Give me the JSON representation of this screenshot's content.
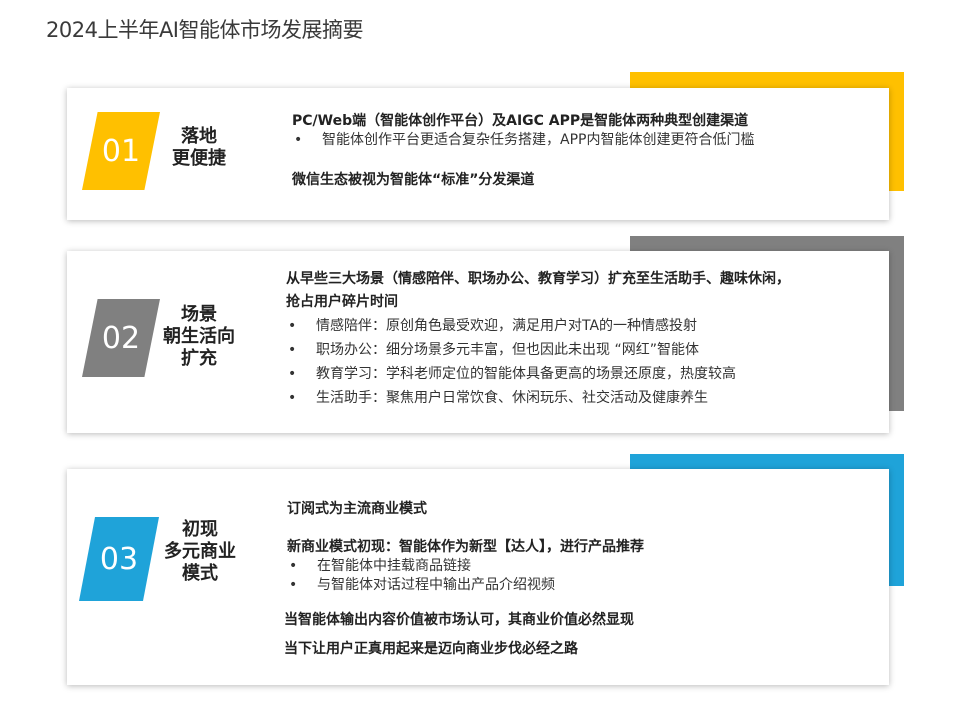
{
  "title": "2024上半年AI智能体市场发展摘要",
  "colors": {
    "yellow": "#FFC000",
    "gray": "#808080",
    "blue": "#1FA3D9"
  },
  "sections": [
    {
      "number": "01",
      "title_lines": [
        "落地",
        "更便捷"
      ],
      "heading": "PC/Web端（智能体创作平台）及AIGC APP是智能体两种典型创建渠道",
      "bullets": [
        "智能体创作平台更适合复杂任务搭建，APP内智能体创建更符合低门槛"
      ],
      "footer": "微信生态被视为智能体“标准”分发渠道"
    },
    {
      "number": "02",
      "title_lines": [
        "场景",
        "朝生活向",
        "扩充"
      ],
      "heading_lines": [
        "从早些三大场景（情感陪伴、职场办公、教育学习）扩充至生活助手、趣味休闲，",
        "抢占用户碎片时间"
      ],
      "bullets": [
        "情感陪伴：原创角色最受欢迎，满足用户对TA的一种情感投射",
        "职场办公：细分场景多元丰富，但也因此未出现 “网红”智能体",
        "教育学习：学科老师定位的智能体具备更高的场景还原度，热度较高",
        "生活助手：聚焦用户日常饮食、休闲玩乐、社交活动及健康养生"
      ]
    },
    {
      "number": "03",
      "title_lines": [
        "初现",
        "多元商业",
        "模式"
      ],
      "line1": "订阅式为主流商业模式",
      "line2": "新商业模式初现：智能体作为新型【达人】，进行产品推荐",
      "bullets": [
        "在智能体中挂载商品链接",
        "与智能体对话过程中输出产品介绍视频"
      ],
      "line3": "当智能体输出内容价值被市场认可，其商业价值必然显现",
      "line4": "当下让用户正真用起来是迈向商业步伐必经之路"
    }
  ]
}
